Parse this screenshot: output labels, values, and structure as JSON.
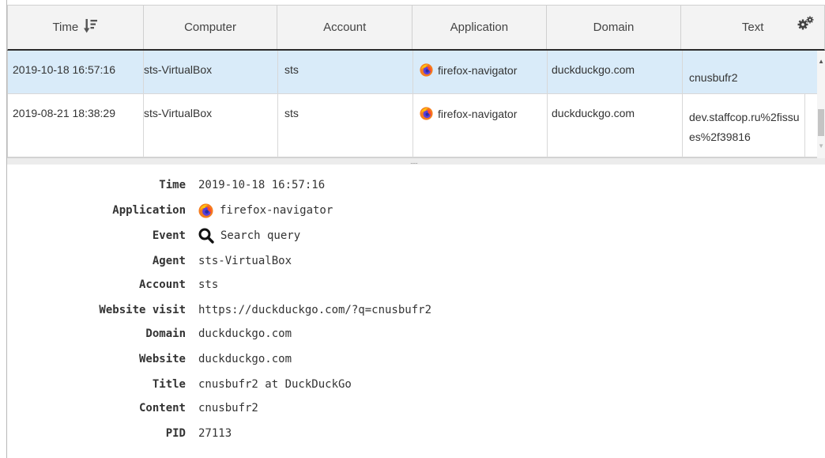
{
  "grid": {
    "columns": [
      {
        "label": "Time"
      },
      {
        "label": "Computer"
      },
      {
        "label": "Account"
      },
      {
        "label": "Application"
      },
      {
        "label": "Domain"
      },
      {
        "label": "Text"
      }
    ],
    "rows": [
      {
        "time": "2019-10-18 16:57:16",
        "computer": "sts-VirtualBox",
        "account": "sts",
        "application": "firefox-navigator",
        "domain": "duckduckgo.com",
        "text": "cnusbufr2",
        "selected": true
      },
      {
        "time": "2019-08-21 18:38:29",
        "computer": "sts-VirtualBox",
        "account": "sts",
        "application": "firefox-navigator",
        "domain": "duckduckgo.com",
        "text": "dev.staffcop.ru%2fissues%2f39816",
        "selected": false
      }
    ],
    "sort_icon": "sort-descending-icon",
    "settings_icon": "gears-icon",
    "app_icon": "firefox-icon"
  },
  "details": {
    "time": {
      "label": "Time",
      "value": "2019-10-18 16:57:16"
    },
    "application": {
      "label": "Application",
      "value": "firefox-navigator",
      "icon": "firefox-icon"
    },
    "event": {
      "label": "Event",
      "value": "Search query",
      "icon": "search-icon"
    },
    "agent": {
      "label": "Agent",
      "value": "sts-VirtualBox"
    },
    "account": {
      "label": "Account",
      "value": "sts"
    },
    "website_visit": {
      "label": "Website visit",
      "value": "https://duckduckgo.com/?q=cnusbufr2"
    },
    "domain": {
      "label": "Domain",
      "value": "duckduckgo.com"
    },
    "website": {
      "label": "Website",
      "value": "duckduckgo.com"
    },
    "title": {
      "label": "Title",
      "value": "cnusbufr2 at DuckDuckGo"
    },
    "content": {
      "label": "Content",
      "value": "cnusbufr2"
    },
    "pid": {
      "label": "PID",
      "value": "27113"
    }
  },
  "colors": {
    "selected_row": "#d9ebf9",
    "header_bg": "#f3f3f3",
    "header_border": "#2a2a2a"
  }
}
